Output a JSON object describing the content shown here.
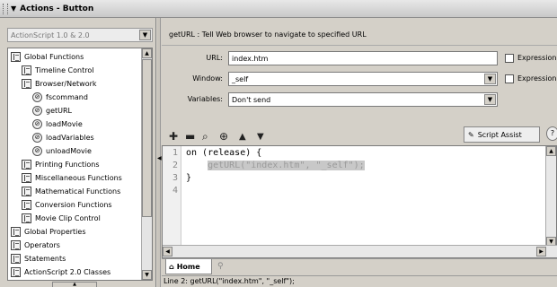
{
  "panel": {
    "title": "Actions - Button",
    "collapse_icon": "triangle-down-icon"
  },
  "left": {
    "version_select": "ActionScript 1.0 & 2.0",
    "tree": [
      {
        "label": "Global Functions",
        "icon": "book-icon",
        "indent": 0
      },
      {
        "label": "Timeline Control",
        "icon": "book-icon",
        "indent": 1
      },
      {
        "label": "Browser/Network",
        "icon": "book-icon",
        "indent": 1
      },
      {
        "label": "fscommand",
        "icon": "function-icon",
        "indent": 2
      },
      {
        "label": "getURL",
        "icon": "function-icon",
        "indent": 2
      },
      {
        "label": "loadMovie",
        "icon": "function-icon",
        "indent": 2
      },
      {
        "label": "loadVariables",
        "icon": "function-icon",
        "indent": 2
      },
      {
        "label": "unloadMovie",
        "icon": "function-icon",
        "indent": 2
      },
      {
        "label": "Printing Functions",
        "icon": "book-icon",
        "indent": 1
      },
      {
        "label": "Miscellaneous Functions",
        "icon": "book-icon",
        "indent": 1
      },
      {
        "label": "Mathematical Functions",
        "icon": "book-icon",
        "indent": 1
      },
      {
        "label": "Conversion Functions",
        "icon": "book-icon",
        "indent": 1
      },
      {
        "label": "Movie Clip Control",
        "icon": "book-icon",
        "indent": 1
      },
      {
        "label": "Global Properties",
        "icon": "book-icon",
        "indent": 0
      },
      {
        "label": "Operators",
        "icon": "book-icon",
        "indent": 0
      },
      {
        "label": "Statements",
        "icon": "book-icon",
        "indent": 0
      },
      {
        "label": "ActionScript 2.0 Classes",
        "icon": "book-icon",
        "indent": 0
      }
    ]
  },
  "right": {
    "description": "getURL : Tell Web browser to navigate to specified URL",
    "url_label": "URL:",
    "url_value": "index.htm",
    "window_label": "Window:",
    "window_value": "_self",
    "variables_label": "Variables:",
    "variables_value": "Don't send",
    "expression_label": "Expression",
    "toolbar_icons": [
      "add-icon",
      "remove-icon",
      "find-icon",
      "target-icon",
      "move-up-icon",
      "move-down-icon"
    ],
    "script_assist_label": "Script Assist",
    "help_icon": "help-icon"
  },
  "editor": {
    "line_numbers": [
      "1",
      "2",
      "3",
      "4"
    ],
    "lines": [
      "on (release) {",
      "    getURL(\"index.htm\", \"_self\");",
      "}",
      ""
    ],
    "selected_line": 2
  },
  "tabs": {
    "home_label": "Home",
    "pin_icon": "pin-icon"
  },
  "status": "Line 2: getURL(\"index.htm\", \"_self\");"
}
